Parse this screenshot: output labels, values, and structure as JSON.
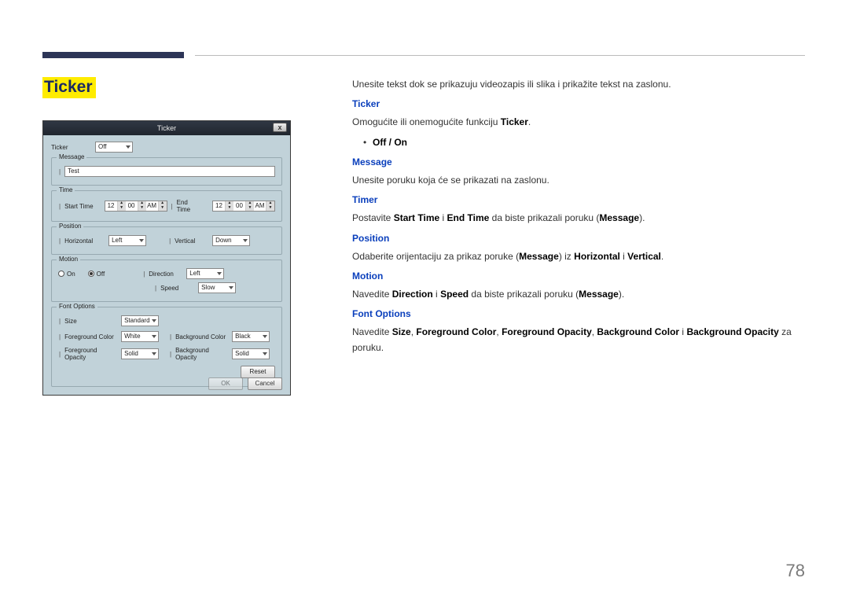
{
  "page": {
    "number": "78"
  },
  "section": {
    "title": "Ticker"
  },
  "dialog": {
    "title": "Ticker",
    "close_glyph": "x",
    "labels": {
      "ticker": "Ticker",
      "message": "Message",
      "time": "Time",
      "start_time": "Start Time",
      "end_time": "End Time",
      "position": "Position",
      "horizontal": "Horizontal",
      "vertical": "Vertical",
      "motion": "Motion",
      "on": "On",
      "off": "Off",
      "direction": "Direction",
      "speed": "Speed",
      "font_options": "Font Options",
      "size": "Size",
      "bg_color": "Background Color",
      "fg_color": "Foreground Color",
      "bg_opacity": "Background Opacity",
      "fg_opacity": "Foreground Opacity",
      "reset": "Reset",
      "ok": "OK",
      "cancel": "Cancel"
    },
    "values": {
      "ticker_mode": "Off",
      "message_text": "Test",
      "start_h": "12",
      "start_m": "00",
      "start_ampm": "AM",
      "end_h": "12",
      "end_m": "00",
      "end_ampm": "AM",
      "horizontal": "Left",
      "vertical": "Down",
      "direction": "Left",
      "speed": "Slow",
      "size": "Standard",
      "fg_color": "White",
      "fg_opacity": "Solid",
      "bg_color": "Black",
      "bg_opacity": "Solid"
    }
  },
  "desc": {
    "intro": "Unesite tekst dok se prikazuju videozapis ili slika i prikažite tekst na zaslonu.",
    "ticker_head": "Ticker",
    "ticker_body_pre": "Omogućite ili onemogućite funkciju ",
    "ticker_body_bold": "Ticker",
    "ticker_body_post": ".",
    "off_on_bullet": "Off / On",
    "message_head": "Message",
    "message_body": "Unesite poruku koja će se prikazati na zaslonu.",
    "timer_head": "Timer",
    "timer_body_pre": "Postavite ",
    "timer_b1": "Start Time",
    "timer_mid1": " i ",
    "timer_b2": "End Time",
    "timer_mid2": " da biste prikazali poruku (",
    "timer_b3": "Message",
    "timer_post": ").",
    "position_head": "Position",
    "position_body_pre": "Odaberite orijentaciju za prikaz poruke (",
    "position_b1": "Message",
    "position_mid1": ") iz ",
    "position_b2": "Horizontal",
    "position_mid2": " i ",
    "position_b3": "Vertical",
    "position_post": ".",
    "motion_head": "Motion",
    "motion_body_pre": "Navedite ",
    "motion_b1": "Direction",
    "motion_mid1": " i ",
    "motion_b2": "Speed",
    "motion_mid2": " da biste prikazali poruku (",
    "motion_b3": "Message",
    "motion_post": ").",
    "font_head": "Font Options",
    "font_body_pre": "Navedite ",
    "font_b1": "Size",
    "font_c": ", ",
    "font_b2": "Foreground Color",
    "font_b3": "Foreground Opacity",
    "font_b4": "Background Color",
    "font_i": " i ",
    "font_b5": "Background Opacity",
    "font_post": " za poruku."
  }
}
